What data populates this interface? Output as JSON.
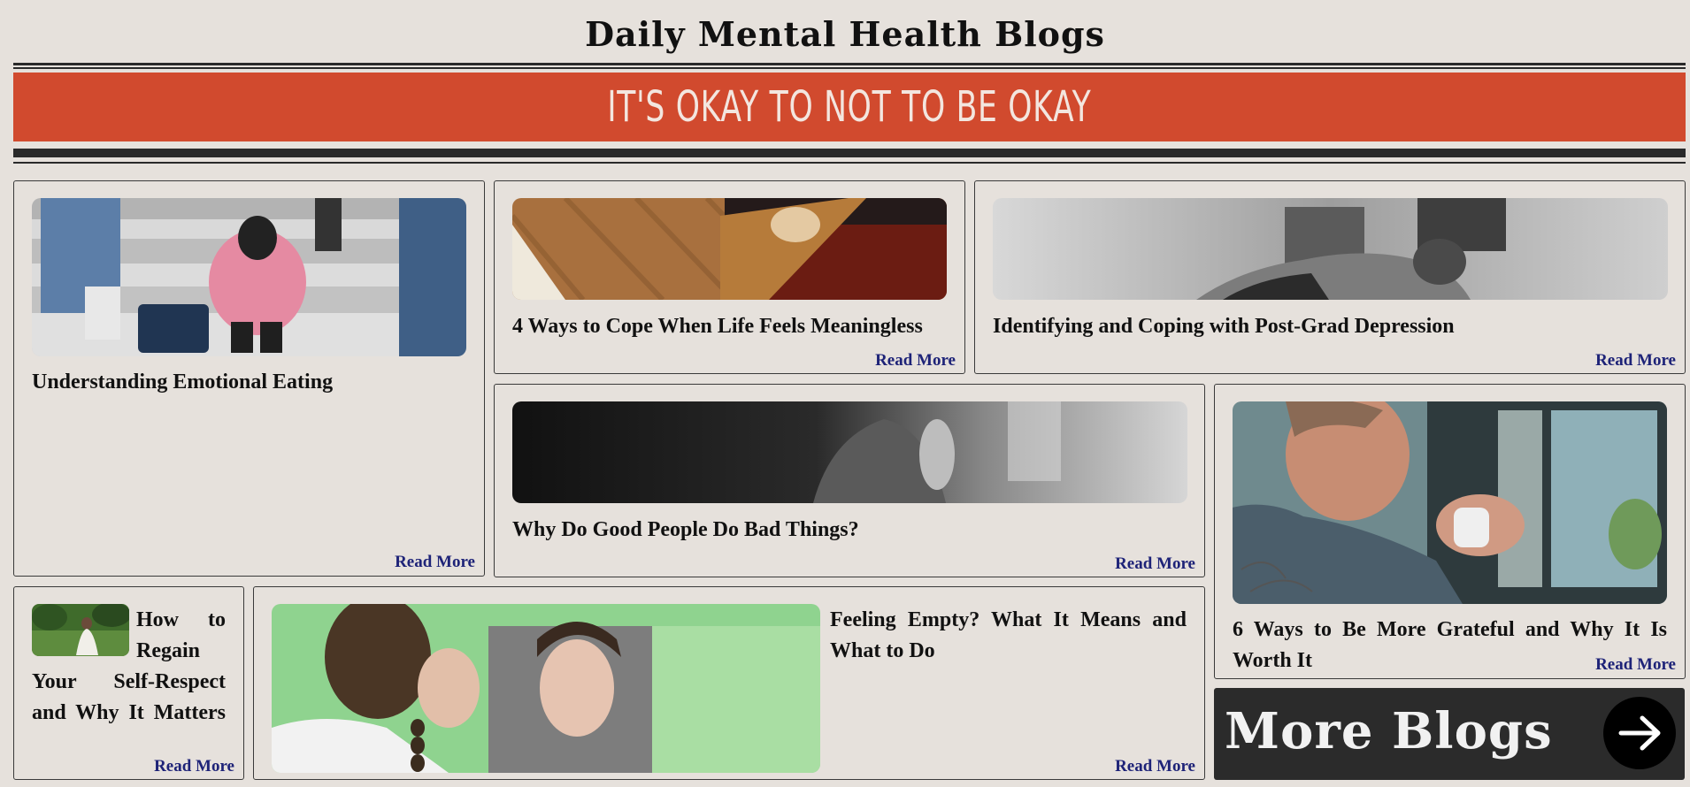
{
  "site": {
    "title": "Daily Mental Health Blogs",
    "banner": "It's okay to not to be okay"
  },
  "colors": {
    "background": "#e6e1dc",
    "banner": "#d14a2e",
    "banner_text": "#f3e6df",
    "link": "#1e2378",
    "dark": "#2b2b2b"
  },
  "posts": [
    {
      "title": "Understanding Emotional Eating",
      "link_label": "Read More",
      "image": "person-sitting-on-stairs-photo"
    },
    {
      "title": "4 Ways to Cope When Life Feels Meaningless",
      "link_label": "Read More",
      "image": "person-on-couch-photo"
    },
    {
      "title": "Identifying and Coping with Post-Grad Depression",
      "link_label": "Read More",
      "image": "man-head-down-photo"
    },
    {
      "title": "Why Do Good People Do Bad Things?",
      "link_label": "Read More",
      "image": "dark-bedroom-photo"
    },
    {
      "title": "6 Ways to Be More Grateful and Why It Is Worth It",
      "link_label": "Read More",
      "image": "woman-holding-cup-photo"
    },
    {
      "title": "How to Regain Your Self-Respect and Why It Matters",
      "link_label": "Read More",
      "image": "woman-sitting-on-grass-photo"
    },
    {
      "title": "Feeling Empty? What It Means and What to Do",
      "link_label": "Read More",
      "image": "woman-mirror-reflection-photo"
    }
  ],
  "more_blogs": {
    "label": "More Blogs",
    "icon": "arrow-right-icon"
  }
}
